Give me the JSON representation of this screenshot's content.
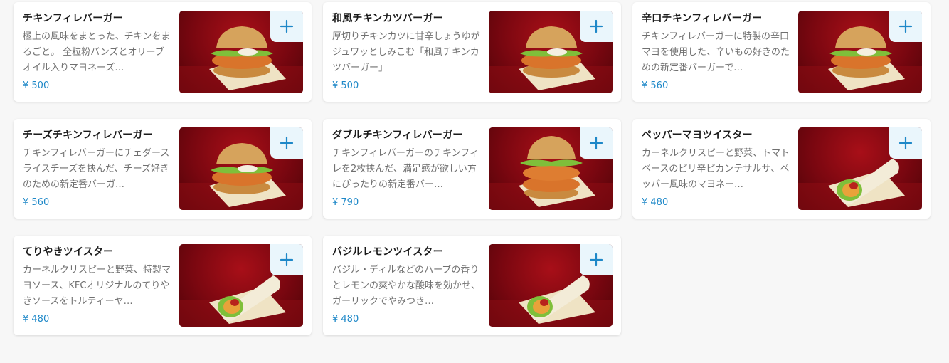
{
  "colors": {
    "background": "#f7f7f7",
    "card": "#ffffff",
    "price": "#1e88c8",
    "add_button_bg": "#eaf6fc",
    "add_button_icon": "#1e88c8"
  },
  "menu_items": [
    {
      "name": "チキンフィレバーガー",
      "description": "極上の風味をまとった、チキンをまるごと。 全粒粉バンズとオリーブオイル入りマヨネーズ…",
      "price": "¥ 500",
      "photo": "burger"
    },
    {
      "name": "和風チキンカツバーガー",
      "description": "厚切りチキンカツに甘辛しょうゆがジュワッとしみこむ「和風チキンカツバーガー」",
      "price": "¥ 500",
      "photo": "burger"
    },
    {
      "name": "辛口チキンフィレバーガー",
      "description": "チキンフィレバーガーに特製の辛口マヨを使用した、辛いもの好きのための新定番バーガーで…",
      "price": "¥ 560",
      "photo": "burger"
    },
    {
      "name": "チーズチキンフィレバーガー",
      "description": "チキンフィレバーガーにチェダースライスチーズを挟んだ、チーズ好きのための新定番バーガ…",
      "price": "¥ 560",
      "photo": "burger"
    },
    {
      "name": "ダブルチキンフィレバーガー",
      "description": "チキンフィレバーガーのチキンフィレを2枚挟んだ、満足感が欲しい方にぴったりの新定番バー…",
      "price": "¥ 790",
      "photo": "double-burger"
    },
    {
      "name": "ペッパーマヨツイスター",
      "description": "カーネルクリスピーと野菜、トマトベースのピリ辛ピカンテサルサ、ペッパー風味のマヨネー…",
      "price": "¥ 480",
      "photo": "wrap"
    },
    {
      "name": "てりやきツイスター",
      "description": "カーネルクリスピーと野菜、特製マヨソース、KFCオリジナルのてりやきソースをトルティーヤ…",
      "price": "¥ 480",
      "photo": "wrap"
    },
    {
      "name": "バジルレモンツイスター",
      "description": "バジル・ディルなどのハーブの香りとレモンの爽やかな酸味を効かせ、ガーリックでやみつき…",
      "price": "¥ 480",
      "photo": "wrap"
    }
  ]
}
